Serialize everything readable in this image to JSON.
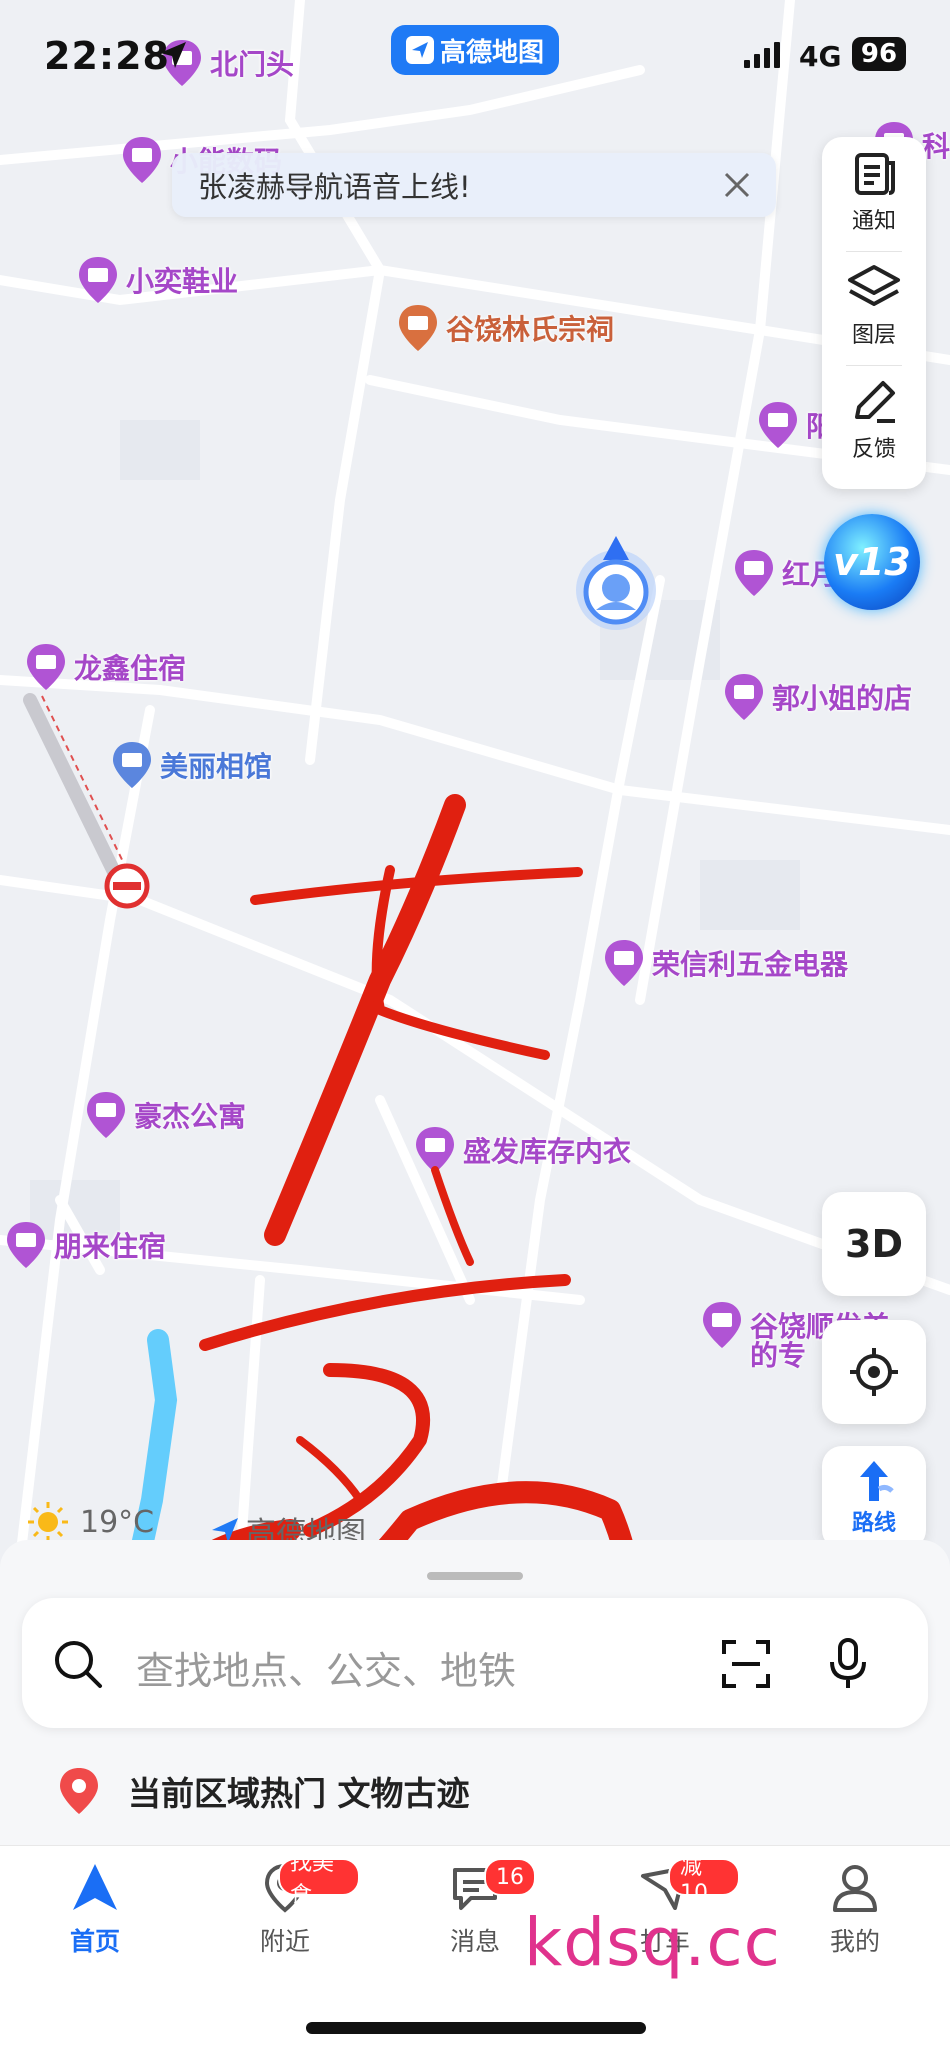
{
  "status_bar": {
    "time": "22:28",
    "network": "4G",
    "battery": "96"
  },
  "app_pill": {
    "label": "高德地图"
  },
  "notice": {
    "text": "张凌赫导航语音上线!"
  },
  "tools": [
    {
      "label": "通知",
      "icon": "notice-icon"
    },
    {
      "label": "图层",
      "icon": "layers-icon"
    },
    {
      "label": "反馈",
      "icon": "feedback-icon"
    }
  ],
  "level_badge": {
    "text": "v13"
  },
  "map_labels": [
    {
      "name": "poi-beimentou",
      "text": "北门头",
      "color": "#a547c8"
    },
    {
      "name": "poi-xiaoneng",
      "text": "小能数码",
      "color": "#a547c8"
    },
    {
      "name": "poi-xiaoyi",
      "text": "小奕鞋业",
      "color": "#a547c8"
    },
    {
      "name": "poi-guraoci",
      "text": "谷饶林氏宗祠",
      "color": "#c9603a"
    },
    {
      "name": "poi-kexue",
      "text": "科",
      "color": "#a547c8"
    },
    {
      "name": "poi-yang",
      "text": "阳",
      "color": "#a547c8"
    },
    {
      "name": "poi-hongyue",
      "text": "红月",
      "color": "#a547c8"
    },
    {
      "name": "poi-longxin",
      "text": "龙鑫住宿",
      "color": "#a547c8"
    },
    {
      "name": "poi-meili",
      "text": "美丽相馆",
      "color": "#4a78d8"
    },
    {
      "name": "poi-guo",
      "text": "郭小姐的店",
      "color": "#a547c8"
    },
    {
      "name": "poi-rongxin",
      "text": "荣信利五金电器",
      "color": "#a547c8"
    },
    {
      "name": "poi-haojie",
      "text": "豪杰公寓",
      "color": "#a547c8"
    },
    {
      "name": "poi-shengfa",
      "text": "盛发库存内衣",
      "color": "#a547c8"
    },
    {
      "name": "poi-penglai",
      "text": "朋来住宿",
      "color": "#a547c8"
    },
    {
      "name": "poi-shunfa",
      "text": "谷饶顺发美",
      "color": "#a547c8"
    },
    {
      "name": "poi-shunfa2",
      "text": "的专",
      "color": "#a547c8"
    }
  ],
  "buttons": {
    "three_d": "3D",
    "route": "路线"
  },
  "weather": {
    "temp": "19°C",
    "brand": "高德地图"
  },
  "search": {
    "placeholder": "查找地点、公交、地铁"
  },
  "hot": {
    "text": "当前区域热门 文物古迹"
  },
  "tabs": [
    {
      "label": "首页",
      "active": true
    },
    {
      "label": "附近",
      "badge": "找美食"
    },
    {
      "label": "消息",
      "badge": "16"
    },
    {
      "label": "打车",
      "badge": "减10"
    },
    {
      "label": "我的"
    }
  ],
  "handwriting": {
    "text": "东高",
    "color": "#e02010"
  },
  "watermark": {
    "text": "kdsq.cc"
  },
  "colors": {
    "accent": "#1a6ef5",
    "poi": "#a547c8",
    "badge": "#ff3333"
  }
}
